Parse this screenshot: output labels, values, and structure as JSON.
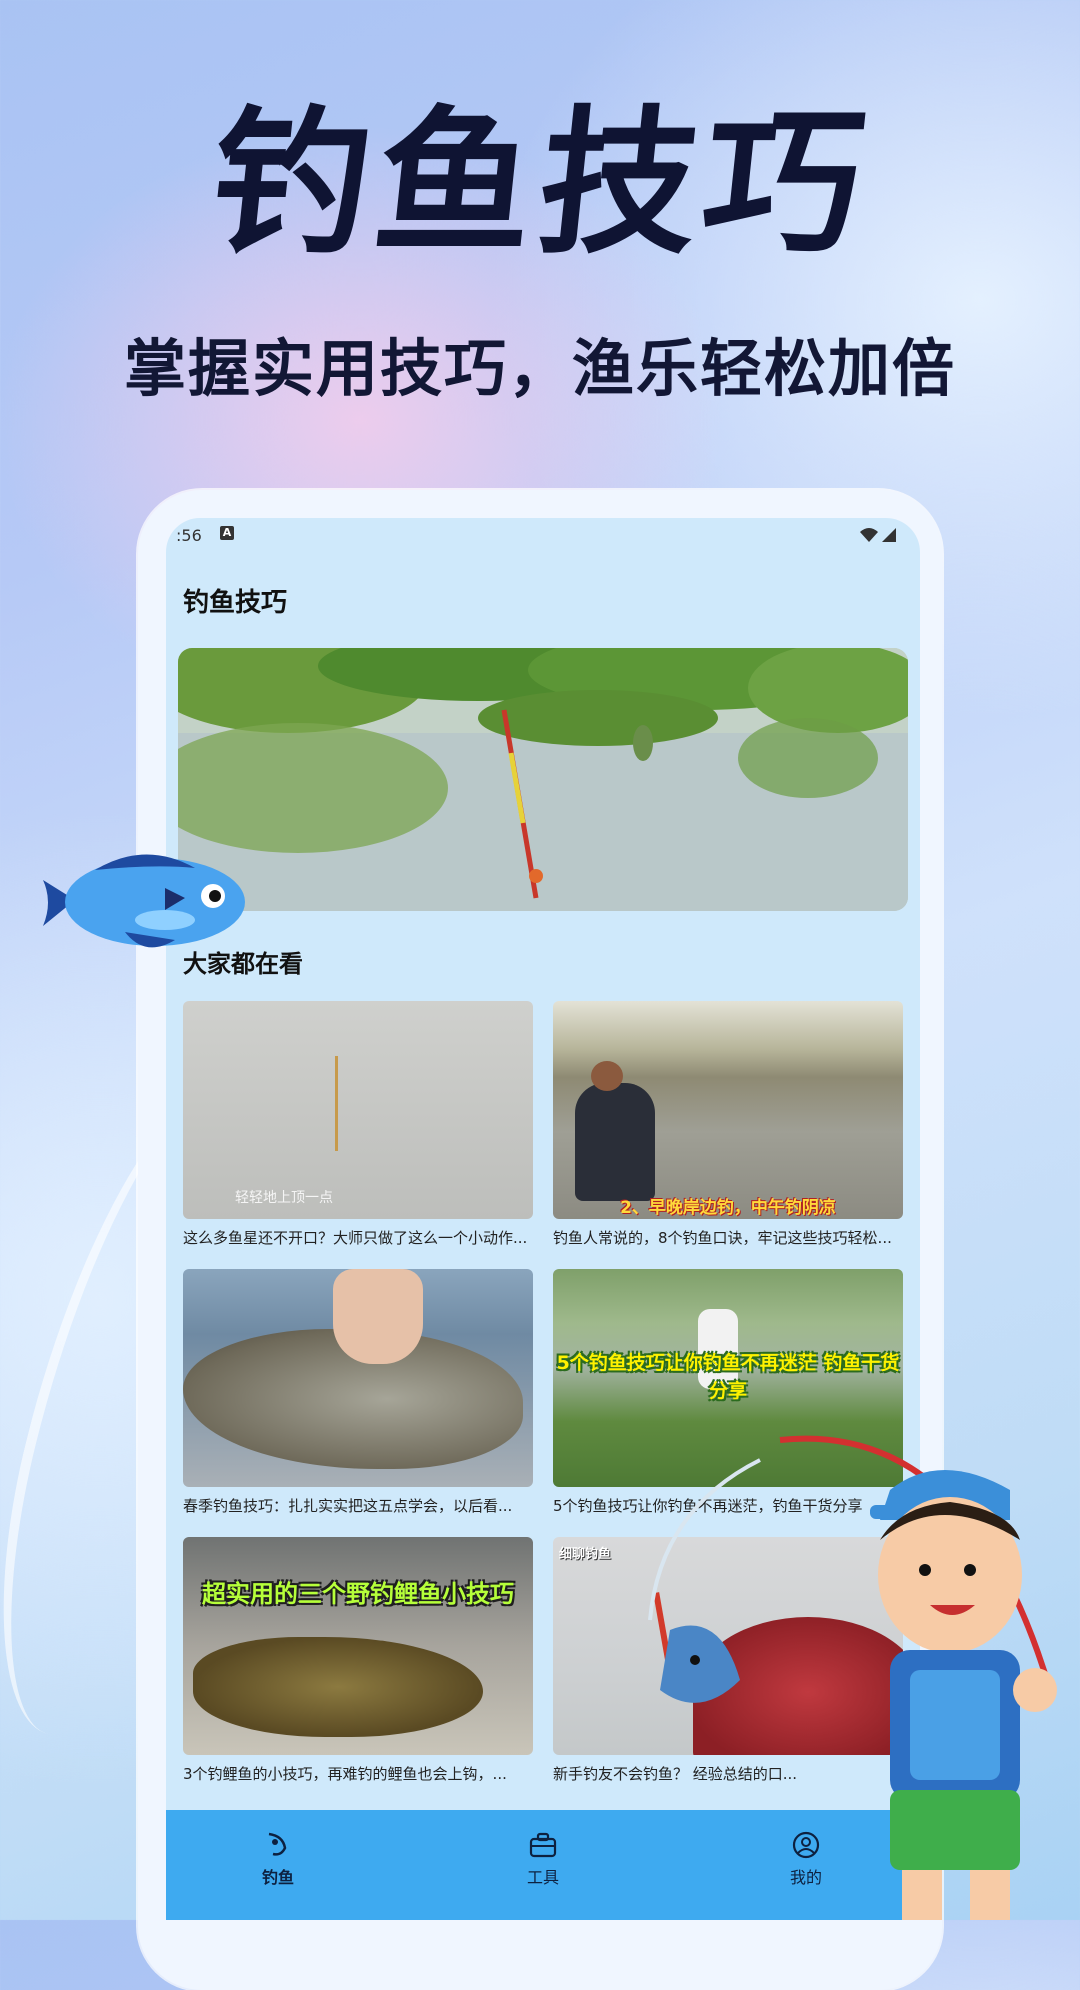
{
  "hero": {
    "title": "钓鱼技巧",
    "subtitle": "掌握实用技巧，渔乐轻松加倍"
  },
  "status_bar": {
    "time": ":56",
    "icons": [
      "a-icon",
      "wifi-icon",
      "signal-icon"
    ]
  },
  "app": {
    "title": "钓鱼技巧",
    "section_title": "大家都在看"
  },
  "cards": [
    {
      "caption": "这么多鱼星还不开口？大师只做了这么一个小动作...",
      "overlay": "轻轻地上顶一点"
    },
    {
      "caption": "钓鱼人常说的，8个钓鱼口诀，牢记这些技巧轻松...",
      "overlay": "2、早晚岸边钓，中午钓阴凉"
    },
    {
      "caption": "春季钓鱼技巧：扎扎实实把这五点学会，以后看...",
      "overlay": ""
    },
    {
      "caption": "5个钓鱼技巧让你钓鱼不再迷茫，钓鱼干货分享",
      "overlay": "5个钓鱼技巧让你钓鱼不再迷茫 钓鱼干货分享"
    },
    {
      "caption": "3个钓鲤鱼的小技巧，再难钓的鲤鱼也会上钩，...",
      "overlay": "超实用的三个野钓鲤鱼小技巧"
    },
    {
      "caption": "新手钓友不会钓鱼？                        经验总结的口...",
      "overlay": "细聊钓鱼"
    }
  ],
  "nav": {
    "items": [
      {
        "label": "钓鱼",
        "icon": "fishing-icon"
      },
      {
        "label": "工具",
        "icon": "toolbox-icon"
      },
      {
        "label": "我的",
        "icon": "profile-icon"
      }
    ]
  },
  "colors": {
    "screen_bg": "#cfe9fb",
    "nav_bg": "#3eaaf0",
    "title_color": "#0f1433"
  }
}
